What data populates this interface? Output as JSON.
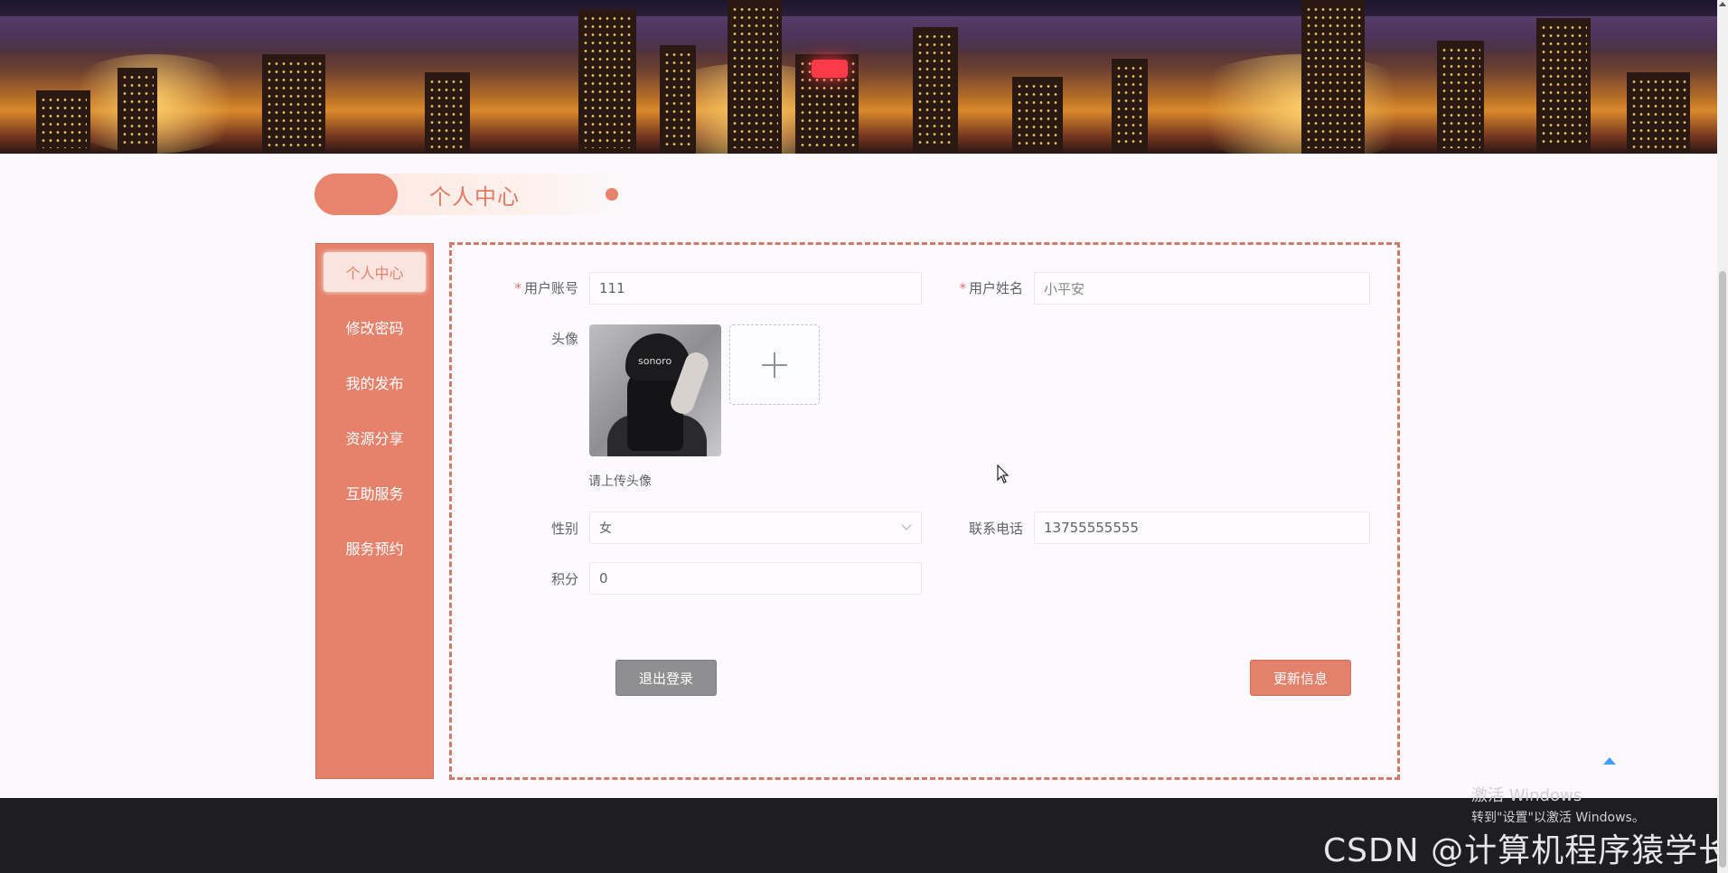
{
  "header": {
    "title": "个人中心"
  },
  "sidebar": {
    "items": [
      {
        "label": "个人中心",
        "active": true
      },
      {
        "label": "修改密码"
      },
      {
        "label": "我的发布"
      },
      {
        "label": "资源分享"
      },
      {
        "label": "互助服务"
      },
      {
        "label": "服务预约"
      }
    ]
  },
  "form": {
    "account": {
      "label": "用户账号",
      "required_mark": "*",
      "value": "111"
    },
    "name": {
      "label": "用户姓名",
      "required_mark": "*",
      "value": "小平安"
    },
    "avatar": {
      "label": "头像",
      "image_text": "sonoro",
      "hint": "请上传头像"
    },
    "gender": {
      "label": "性别",
      "value": "女"
    },
    "phone": {
      "label": "联系电话",
      "value": "13755555555"
    },
    "points": {
      "label": "积分",
      "value": "0"
    }
  },
  "buttons": {
    "logout": "退出登录",
    "update": "更新信息"
  },
  "overlay": {
    "activate_title": "激活 Windows",
    "activate_subtitle": "转到\"设置\"以激活 Windows。",
    "watermark": "CSDN @计算机程序猿学长"
  },
  "colors": {
    "accent": "#e6826c",
    "logout_button": "#8f8f91",
    "footer": "#1e1d1f"
  }
}
